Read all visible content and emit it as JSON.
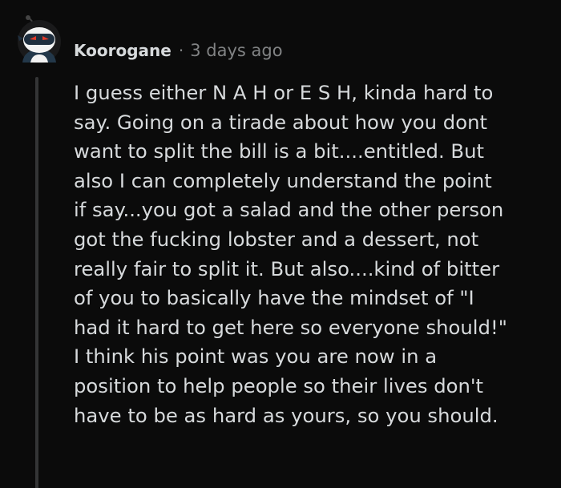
{
  "comment": {
    "author": "Koorogane",
    "separator": "·",
    "timestamp": "3 days ago",
    "avatar_icon": "ninja-avatar-icon",
    "body": "I guess either N A H or E S H, kinda hard to\nsay. Going on a tirade about how you dont\nwant to split the bill is a bit....entitled. But\nalso I can completely understand the point\nif say...you got a salad and the other person\ngot the fucking lobster and a dessert, not\nreally fair to split it. But also....kind of bitter\nof you to basically have the mindset of \"I\nhad it hard to get here so everyone should!\"\nI think his point was you are now in a\nposition to help people so their lives don't\nhave to be as hard as yours, so you should."
  },
  "colors": {
    "background": "#0b0b0b",
    "text": "#d7dadc",
    "muted": "#818384",
    "thread_line": "#343536",
    "avatar_accent": "#e23a2a"
  }
}
